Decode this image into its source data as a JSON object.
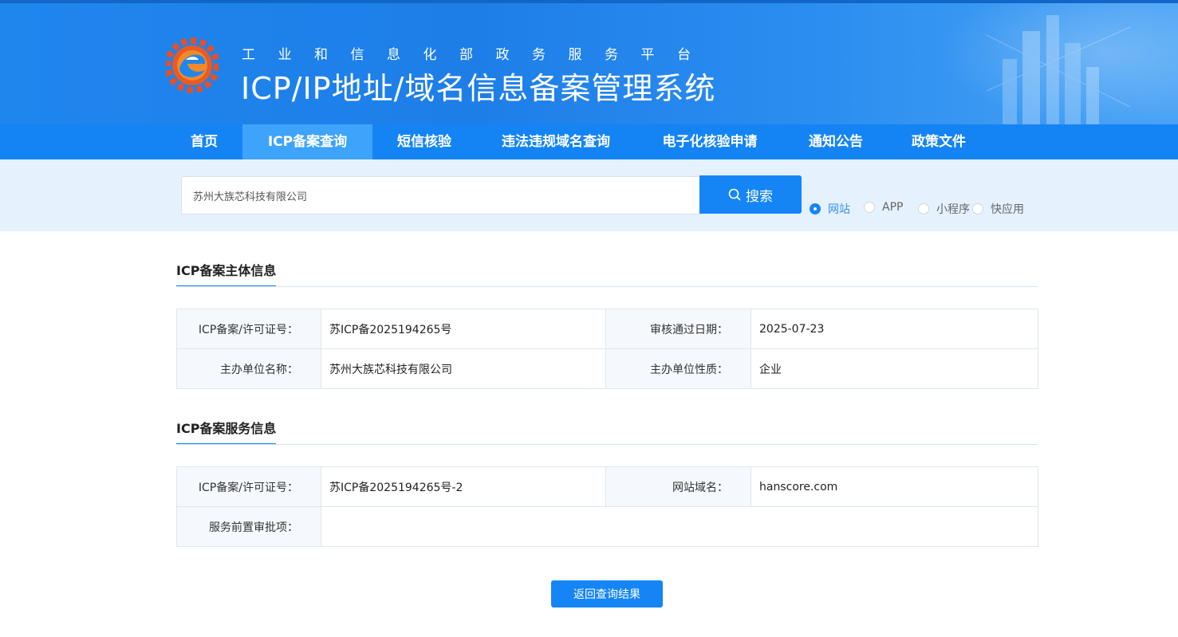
{
  "header": {
    "subtitle": "工业和信息化部政务服务平台",
    "title": "ICP/IP地址/域名信息备案管理系统"
  },
  "nav": {
    "items": [
      {
        "label": "首页"
      },
      {
        "label": "ICP备案查询",
        "active": true
      },
      {
        "label": "短信核验"
      },
      {
        "label": "违法违规域名查询"
      },
      {
        "label": "电子化核验申请"
      },
      {
        "label": "通知公告"
      },
      {
        "label": "政策文件"
      }
    ]
  },
  "search": {
    "value": "苏州大族芯科技有限公司",
    "button_label": "搜索",
    "options": [
      {
        "label": "网站",
        "checked": true
      },
      {
        "label": "APP",
        "checked": false
      },
      {
        "label": "小程序",
        "checked": false
      },
      {
        "label": "快应用",
        "checked": false
      }
    ]
  },
  "subject_info": {
    "title": "ICP备案主体信息",
    "rows": [
      {
        "label1": "ICP备案/许可证号：",
        "value1": "苏ICP备2025194265号",
        "label2": "审核通过日期：",
        "value2": "2025-07-23"
      },
      {
        "label1": "主办单位名称：",
        "value1": "苏州大族芯科技有限公司",
        "label2": "主办单位性质：",
        "value2": "企业"
      }
    ]
  },
  "service_info": {
    "title": "ICP备案服务信息",
    "rows": [
      {
        "label1": "ICP备案/许可证号：",
        "value1": "苏ICP备2025194265号-2",
        "label2": "网站域名：",
        "value2": "hanscore.com"
      }
    ],
    "approval_label": "服务前置审批项：",
    "approval_value": ""
  },
  "back_button_label": "返回查询结果",
  "colors": {
    "primary": "#1585f6",
    "nav_active": "#3ea3fb",
    "strip": "#e5f1fc"
  }
}
